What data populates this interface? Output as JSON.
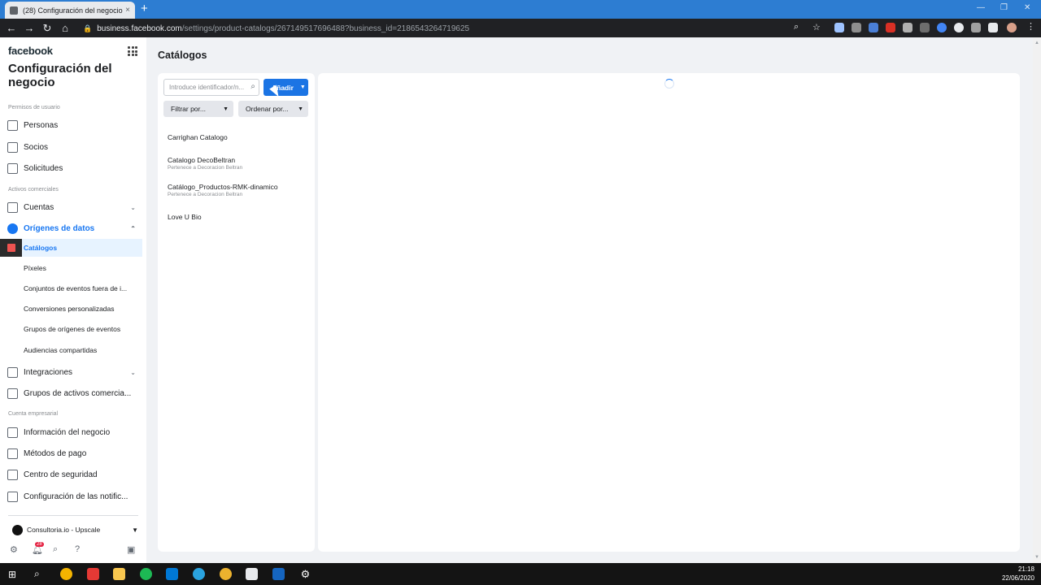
{
  "browser": {
    "tab_title": "(28) Configuración del negocio",
    "tab_close": "×",
    "new_tab": "+",
    "url_host": "business.facebook.com",
    "url_path": "/settings/product-catalogs/267149517696488?business_id=2186543264719625"
  },
  "sidebar": {
    "logo": "facebook",
    "title": "Configuración del negocio",
    "sections": {
      "users": "Permisos de usuario",
      "assets": "Activos comerciales",
      "business": "Cuenta empresarial"
    },
    "items": {
      "people": "Personas",
      "partners": "Socios",
      "requests": "Solicitudes",
      "accounts": "Cuentas",
      "data_sources": "Orígenes de datos",
      "integrations": "Integraciones",
      "asset_groups": "Grupos de activos comercia...",
      "business_info": "Información del negocio",
      "payment_methods": "Métodos de pago",
      "security_center": "Centro de seguridad",
      "notifications": "Configuración de las notific..."
    },
    "sub_items": {
      "catalogs": "Catálogos",
      "pixels": "Píxeles",
      "offline_events": "Conjuntos de eventos fuera de i...",
      "custom_conversions": "Conversiones personalizadas",
      "event_source_groups": "Grupos de orígenes de eventos",
      "shared_audiences": "Audiencias compartidas"
    },
    "account_name": "Consultoria.io - Upscale",
    "notification_count": "28"
  },
  "main": {
    "title": "Catálogos",
    "search_placeholder": "Introduce identificador/n...",
    "add_button": "Añadir",
    "filter_button": "Filtrar por...",
    "sort_button": "Ordenar por...",
    "catalogs": [
      {
        "name": "Carrighan Catalogo",
        "owner": ""
      },
      {
        "name": "Catalogo DecoBeltran",
        "owner": "Pertenece a Decoracion Beltran"
      },
      {
        "name": "Catálogo_Productos-RMK-dinamico",
        "owner": "Pertenece a Decoracion Beltran"
      },
      {
        "name": "Love U Bio",
        "owner": ""
      }
    ]
  },
  "taskbar": {
    "time": "21:18",
    "date": "22/06/2020"
  },
  "colors": {
    "accent": "#1877f2",
    "button": "#1b74e4",
    "browser_tab_bar": "#2d7dd2"
  }
}
